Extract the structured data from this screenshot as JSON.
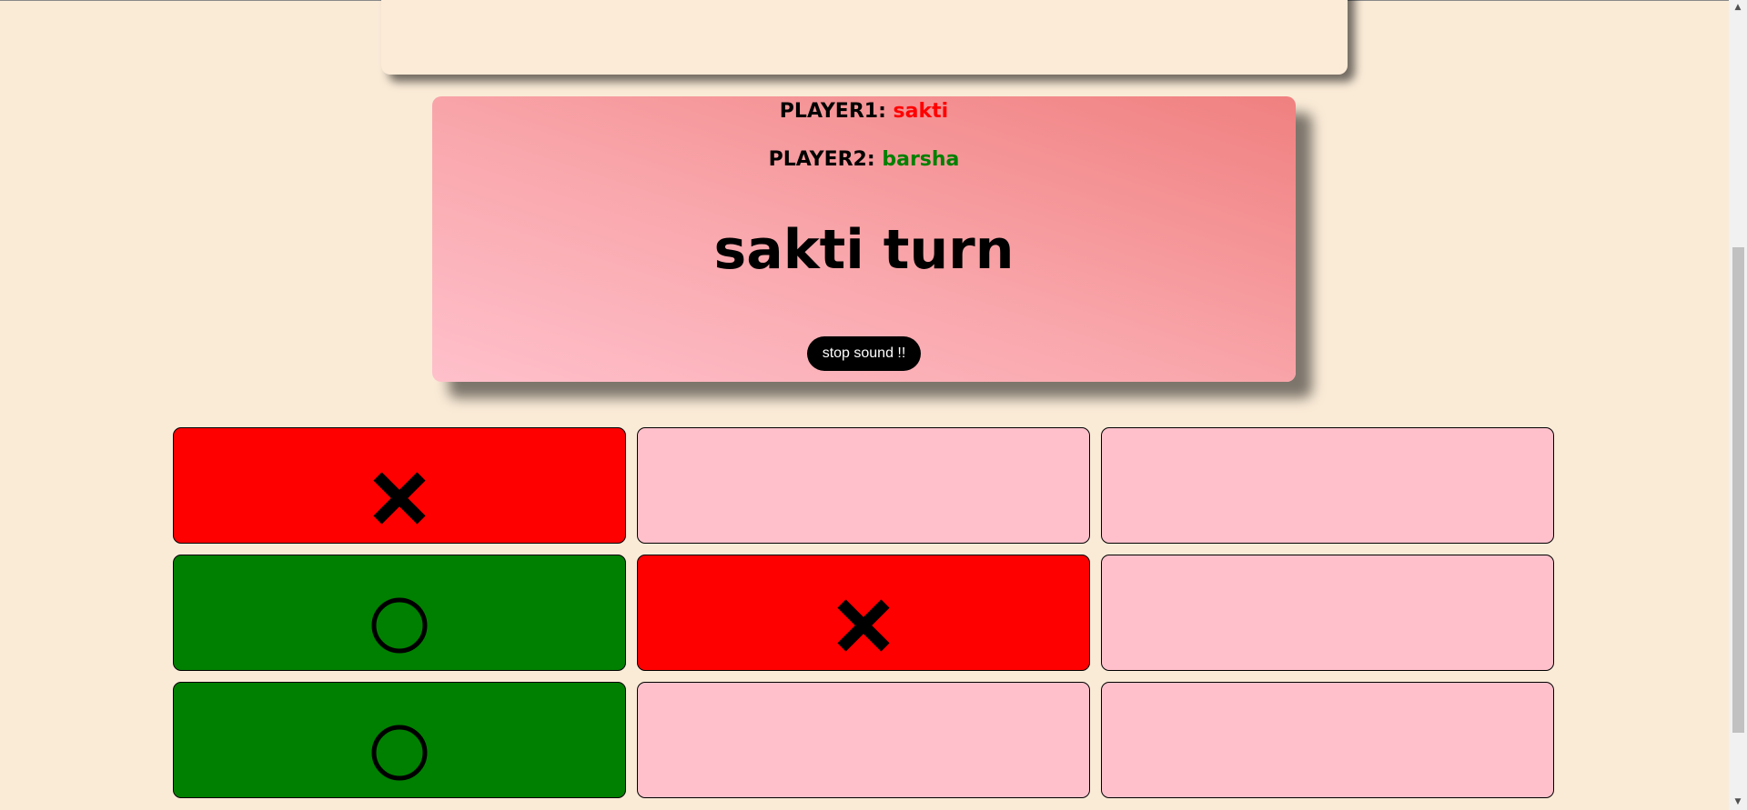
{
  "players": {
    "player1_label": "PLAYER1:",
    "player1_name": "sakti",
    "player2_label": "PLAYER2:",
    "player2_name": "barsha"
  },
  "status": {
    "turn_text": "sakti turn"
  },
  "controls": {
    "stop_sound_label": "stop sound !!"
  },
  "colors": {
    "background": "#faebd7",
    "player1": "#ff0000",
    "player2": "#008000",
    "empty_cell": "#ffc0cb"
  },
  "board": {
    "cells": [
      "X",
      "",
      "",
      "O",
      "X",
      "",
      "O",
      "",
      ""
    ]
  },
  "icons": {
    "x_mark": "cross-icon",
    "o_mark": "circle-icon",
    "scroll_up": "arrow-up-icon",
    "scroll_down": "arrow-down-icon"
  }
}
